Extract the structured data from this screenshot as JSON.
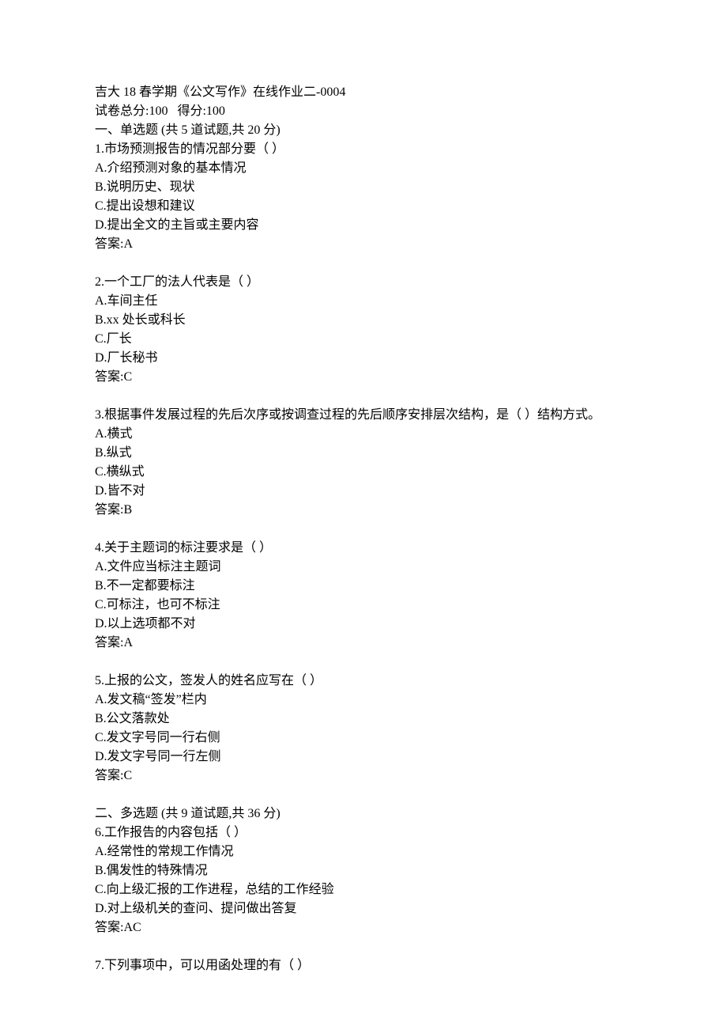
{
  "header": {
    "title": "吉大 18 春学期《公文写作》在线作业二-0004",
    "score_line": "试卷总分:100   得分:100"
  },
  "section1": {
    "heading": "一、单选题 (共 5 道试题,共 20 分)",
    "q1": {
      "stem": "1.市场预测报告的情况部分要（ ）",
      "a": "A.介绍预测对象的基本情况",
      "b": "B.说明历史、现状",
      "c": "C.提出设想和建议",
      "d": "D.提出全文的主旨或主要内容",
      "ans": "答案:A"
    },
    "q2": {
      "stem": "2.一个工厂的法人代表是（ ）",
      "a": "A.车间主任",
      "b": "B.xx 处长或科长",
      "c": "C.厂长",
      "d": "D.厂长秘书",
      "ans": "答案:C"
    },
    "q3": {
      "stem": "3.根据事件发展过程的先后次序或按调查过程的先后顺序安排层次结构，是（ ）结构方式。",
      "a": "A.横式",
      "b": "B.纵式",
      "c": "C.横纵式",
      "d": "D.皆不对",
      "ans": "答案:B"
    },
    "q4": {
      "stem": "4.关于主题词的标注要求是（ ）",
      "a": "A.文件应当标注主题词",
      "b": "B.不一定都要标注",
      "c": "C.可标注，也可不标注",
      "d": "D.以上选项都不对",
      "ans": "答案:A"
    },
    "q5": {
      "stem": "5.上报的公文，签发人的姓名应写在（ ）",
      "a": "A.发文稿“签发”栏内",
      "b": "B.公文落款处",
      "c": "C.发文字号同一行右侧",
      "d": "D.发文字号同一行左侧",
      "ans": "答案:C"
    }
  },
  "section2": {
    "heading": "二、多选题 (共 9 道试题,共 36 分)",
    "q6": {
      "stem": "6.工作报告的内容包括（ ）",
      "a": "A.经常性的常规工作情况",
      "b": "B.偶发性的特殊情况",
      "c": "C.向上级汇报的工作进程，总结的工作经验",
      "d": "D.对上级机关的查问、提问做出答复",
      "ans": "答案:AC"
    },
    "q7": {
      "stem": "7.下列事项中，可以用函处理的有（ ）"
    }
  }
}
